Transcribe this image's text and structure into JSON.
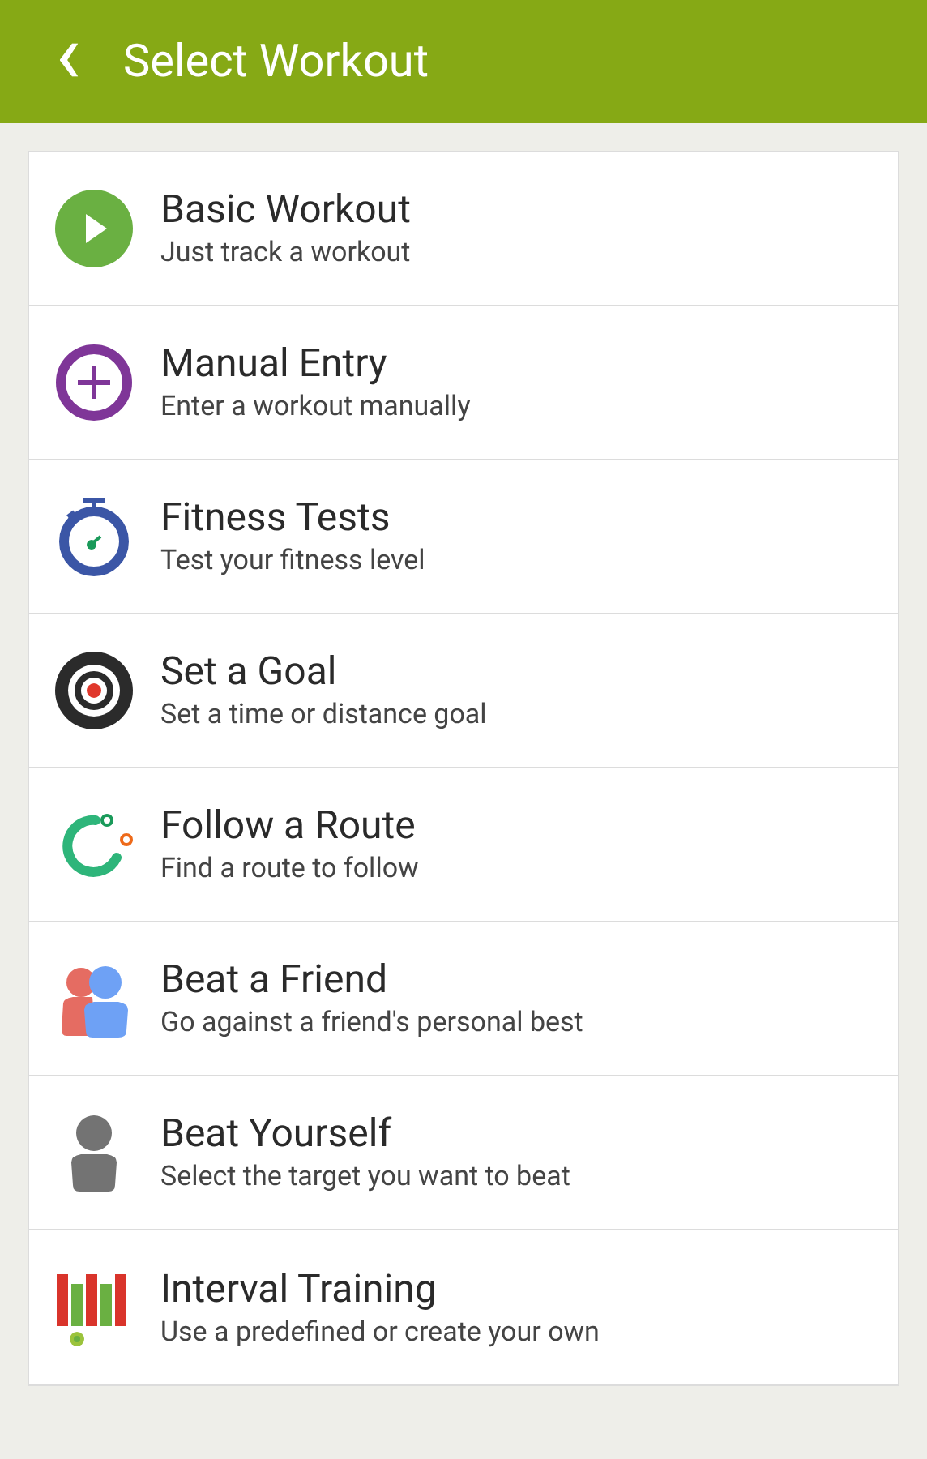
{
  "header": {
    "back_icon": "‹",
    "title": "Select Workout"
  },
  "items": [
    {
      "kind": "play",
      "title": "Basic Workout",
      "subtitle": "Just track a workout"
    },
    {
      "kind": "plus",
      "title": "Manual Entry",
      "subtitle": "Enter a workout manually"
    },
    {
      "kind": "stopwatch",
      "title": "Fitness Tests",
      "subtitle": "Test your fitness level"
    },
    {
      "kind": "target",
      "title": "Set a Goal",
      "subtitle": "Set a time or distance goal"
    },
    {
      "kind": "route",
      "title": "Follow a Route",
      "subtitle": "Find a route to follow"
    },
    {
      "kind": "friends",
      "title": "Beat a Friend",
      "subtitle": "Go against a friend's personal best"
    },
    {
      "kind": "person",
      "title": "Beat Yourself",
      "subtitle": "Select the target you want to beat"
    },
    {
      "kind": "intervals",
      "title": "Interval Training",
      "subtitle": "Use a predefined or create your own"
    }
  ]
}
